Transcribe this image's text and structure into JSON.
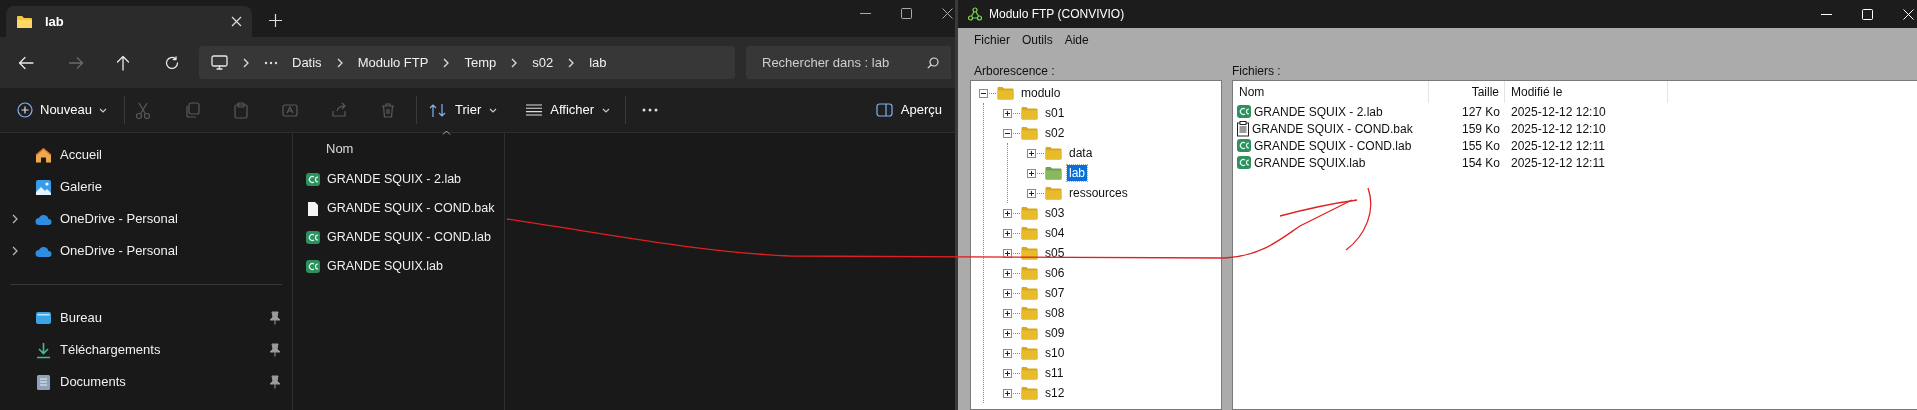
{
  "explorer": {
    "tab": {
      "title": "lab"
    },
    "breadcrumb": [
      "Datis",
      "Modulo FTP",
      "Temp",
      "s02",
      "lab"
    ],
    "search": {
      "placeholder": "Rechercher dans : lab"
    },
    "toolbar": {
      "new": "Nouveau",
      "sort": "Trier",
      "view": "Afficher",
      "preview": "Aperçu"
    },
    "clipboard_actions": [
      {
        "kind": "cut",
        "disabled": true
      },
      {
        "kind": "copy",
        "disabled": true
      },
      {
        "kind": "paste",
        "disabled": true
      },
      {
        "kind": "rename",
        "disabled": true
      },
      {
        "kind": "share",
        "disabled": true
      },
      {
        "kind": "delete",
        "disabled": true
      }
    ],
    "nav_groups": [
      [
        {
          "label": "Accueil",
          "kind": "home",
          "expandable": false,
          "pinned": false
        },
        {
          "label": "Galerie",
          "kind": "gallery",
          "expandable": false,
          "pinned": false
        },
        {
          "label": "OneDrive - Personal",
          "kind": "cloud",
          "expandable": true,
          "pinned": false
        },
        {
          "label": "OneDrive - Personal",
          "kind": "cloud",
          "expandable": true,
          "pinned": false
        }
      ],
      [
        {
          "label": "Bureau",
          "kind": "desktop",
          "expandable": false,
          "pinned": true
        },
        {
          "label": "Téléchargements",
          "kind": "download",
          "expandable": false,
          "pinned": true
        },
        {
          "label": "Documents",
          "kind": "documents",
          "expandable": false,
          "pinned": true
        }
      ]
    ],
    "column": "Nom",
    "files": [
      {
        "name": "GRANDE SQUIX - 2.lab",
        "kind": "cs"
      },
      {
        "name": "GRANDE SQUIX - COND.bak",
        "kind": "blank"
      },
      {
        "name": "GRANDE SQUIX - COND.lab",
        "kind": "cs"
      },
      {
        "name": "GRANDE SQUIX.lab",
        "kind": "cs"
      }
    ]
  },
  "ftp": {
    "title": "Modulo FTP (CONVIVIO)",
    "menu": [
      "Fichier",
      "Outils",
      "Aide"
    ],
    "tree_label": "Arborescence :",
    "files_label": "Fichiers :",
    "tree": {
      "label": "modulo",
      "expanded": true,
      "selected": false,
      "children": [
        {
          "label": "s01",
          "expanded": false,
          "selected": false
        },
        {
          "label": "s02",
          "expanded": true,
          "selected": false,
          "children": [
            {
              "label": "data",
              "expanded": false,
              "selected": false
            },
            {
              "label": "lab",
              "expanded": false,
              "selected": true
            },
            {
              "label": "ressources",
              "expanded": false,
              "selected": false
            }
          ]
        },
        {
          "label": "s03",
          "expanded": false,
          "selected": false
        },
        {
          "label": "s04",
          "expanded": false,
          "selected": false
        },
        {
          "label": "s05",
          "expanded": false,
          "selected": false
        },
        {
          "label": "s06",
          "expanded": false,
          "selected": false
        },
        {
          "label": "s07",
          "expanded": false,
          "selected": false
        },
        {
          "label": "s08",
          "expanded": false,
          "selected": false
        },
        {
          "label": "s09",
          "expanded": false,
          "selected": false
        },
        {
          "label": "s10",
          "expanded": false,
          "selected": false
        },
        {
          "label": "s11",
          "expanded": false,
          "selected": false
        },
        {
          "label": "s12",
          "expanded": false,
          "selected": false
        }
      ]
    },
    "columns": [
      "Nom",
      "Taille",
      "Modifié le"
    ],
    "files": [
      {
        "name": "GRANDE SQUIX - 2.lab",
        "size": "127 Ko",
        "modified": "2025-12-12 12:10",
        "kind": "cs"
      },
      {
        "name": "GRANDE SQUIX - COND.bak",
        "size": "159 Ko",
        "modified": "2025-12-12 12:10",
        "kind": "clipboard"
      },
      {
        "name": "GRANDE SQUIX - COND.lab",
        "size": "155 Ko",
        "modified": "2025-12-12 12:11",
        "kind": "cs"
      },
      {
        "name": "GRANDE SQUIX.lab",
        "size": "154 Ko",
        "modified": "2025-12-12 12:11",
        "kind": "cs"
      }
    ]
  }
}
